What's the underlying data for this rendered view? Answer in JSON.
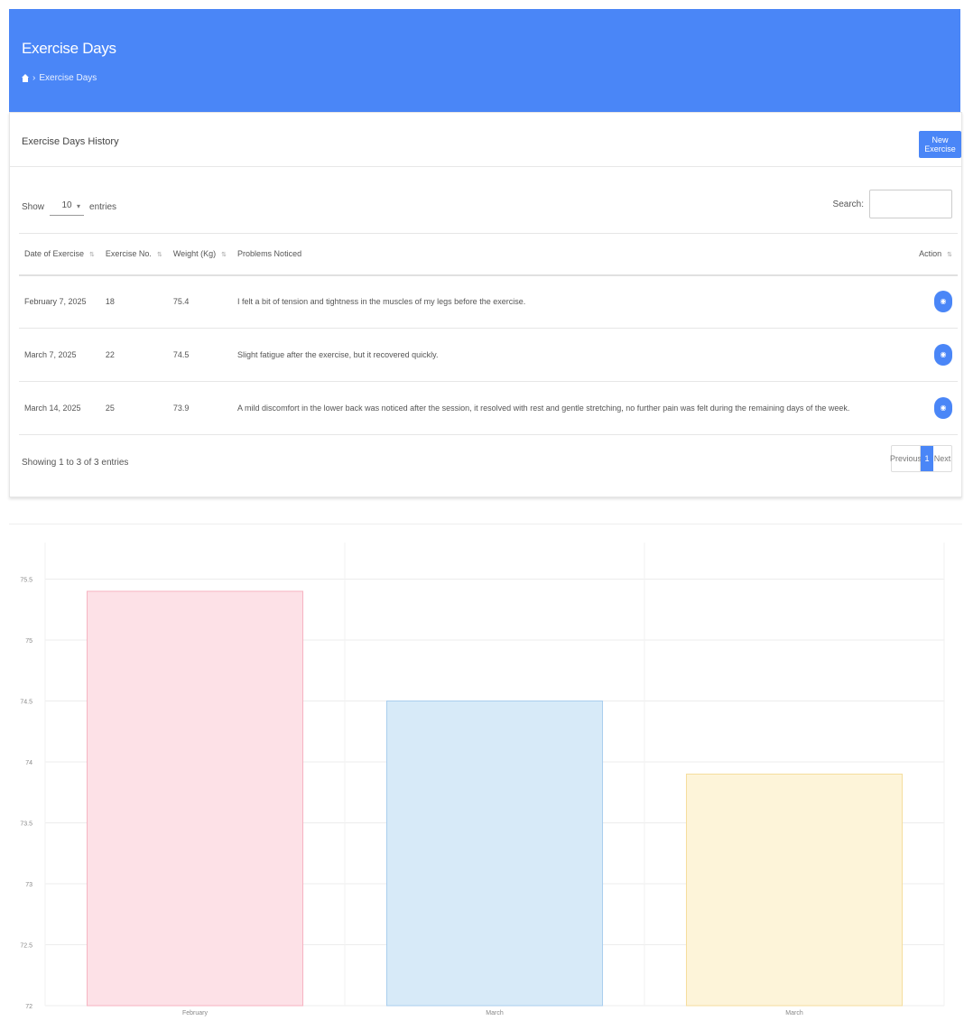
{
  "header": {
    "title": "Exercise Days",
    "breadcrumb_home": "Home",
    "breadcrumb_current": "Exercise Days"
  },
  "card": {
    "title": "Exercise Days History",
    "new_button": "New Exercise",
    "length_label_pre": "Show",
    "length_value": "10",
    "length_label_post": "entries",
    "search_label": "Search:",
    "search_placeholder": "",
    "columns": [
      "Date of Exercise",
      "Exercise No.",
      "Weight (Kg)",
      "Problems Noticed",
      "Action"
    ],
    "rows": [
      {
        "date": "February 7, 2025",
        "no": "18",
        "weight": "75.4",
        "problems": "I felt a bit of tension and tightness in the muscles of my legs before the exercise.",
        "action_icon": "eye-icon"
      },
      {
        "date": "March 7, 2025",
        "no": "22",
        "weight": "74.5",
        "problems": "Slight fatigue after the exercise, but it recovered quickly.",
        "action_icon": "eye-icon"
      },
      {
        "date": "March 14, 2025",
        "no": "25",
        "weight": "73.9",
        "problems": "A mild discomfort in the lower back was noticed after the session, it resolved with rest and gentle stretching, no further pain was felt during the remaining days of the week.",
        "action_icon": "eye-icon"
      }
    ],
    "info": "Showing 1 to 3 of 3 entries",
    "pager": {
      "prev": "Previous",
      "page": "1",
      "next": "Next"
    }
  },
  "colors": {
    "primary": "#4a86f7",
    "bar_colors": [
      "#fde1e7",
      "#d7eaf8",
      "#fdf4d9"
    ],
    "bar_borders": [
      "#f6b3c1",
      "#a9cdee",
      "#f5dd9d"
    ]
  },
  "chart_data": {
    "type": "bar",
    "categories": [
      "February",
      "March",
      "March"
    ],
    "values": [
      75.4,
      74.5,
      73.9
    ],
    "title": "",
    "xlabel": "",
    "ylabel": "",
    "ylim": [
      72.0,
      75.8
    ],
    "yticks": [
      "72",
      "72.5",
      "73",
      "73.5",
      "74",
      "74.5",
      "75",
      "75.5"
    ],
    "grid": true,
    "legend": "none"
  }
}
